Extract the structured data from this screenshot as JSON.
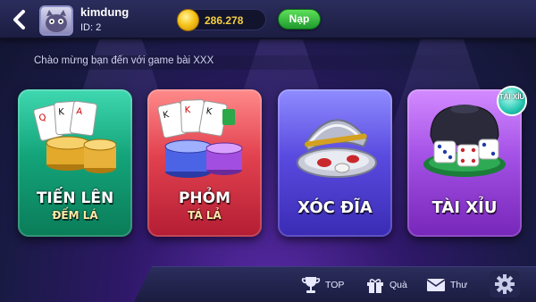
{
  "header": {
    "username": "kimdung",
    "user_id": "ID: 2",
    "balance": "286.278",
    "topup_label": "Nạp"
  },
  "marquee_text": "Chào mừng bạn đến với game bài XXX",
  "games": [
    {
      "title": "TIẾN LÊN",
      "subtitle": "ĐẾM LÁ",
      "color": "#14a47a"
    },
    {
      "title": "PHỎM",
      "subtitle": "TÁ LẢ",
      "color": "#e2424f"
    },
    {
      "title": "XÓC ĐĨA",
      "color": "#5a4be0"
    },
    {
      "title": "TÀI XỈU",
      "color": "#a451e6",
      "badge": "TÀI XỈU"
    }
  ],
  "bottom_nav": {
    "top_label": "TOP",
    "gift_label": "Quà",
    "mail_label": "Thư"
  }
}
